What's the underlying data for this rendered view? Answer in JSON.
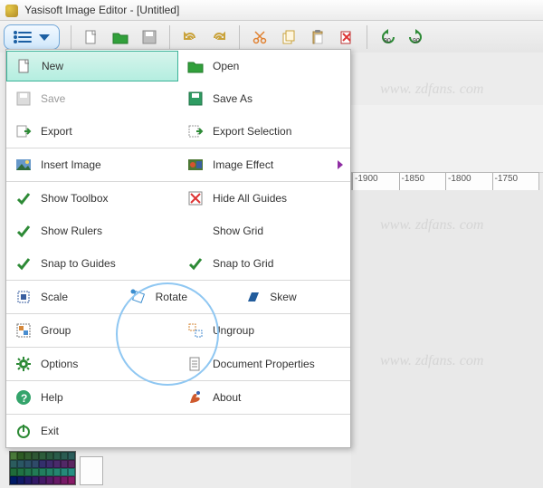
{
  "title": "Yasisoft Image Editor - [Untitled]",
  "toolbar_icons": [
    "menu",
    "new-doc",
    "open-folder",
    "save-disk",
    "undo",
    "redo",
    "cut",
    "copy",
    "paste",
    "delete",
    "rotate-left",
    "rotate-right"
  ],
  "ruler_labels": [
    "-1900",
    "-1850",
    "-1800",
    "-1750"
  ],
  "menu": {
    "new": "New",
    "open": "Open",
    "save": "Save",
    "save_as": "Save As",
    "export": "Export",
    "export_selection": "Export Selection",
    "insert_image": "Insert Image",
    "image_effect": "Image Effect",
    "show_toolbox": "Show Toolbox",
    "hide_guides": "Hide All Guides",
    "show_rulers": "Show Rulers",
    "show_grid": "Show Grid",
    "snap_guides": "Snap to Guides",
    "snap_grid": "Snap to Grid",
    "scale": "Scale",
    "rotate": "Rotate",
    "skew": "Skew",
    "group": "Group",
    "ungroup": "Ungroup",
    "options": "Options",
    "doc_props": "Document Properties",
    "help": "Help",
    "about": "About",
    "exit": "Exit"
  },
  "palette_colors": [
    "#4a7a3a",
    "#2e5c24",
    "#335e2f",
    "#2f5735",
    "#2e5e3b",
    "#2a5a3f",
    "#2a5c4a",
    "#2b5c52",
    "#2c5e5c",
    "#2b5c5e",
    "#2a5664",
    "#2c5067",
    "#2f4a69",
    "#332f6c",
    "#3e2c6d",
    "#4a2a6b",
    "#522866",
    "#5a2660",
    "#1f6b3a",
    "#207143",
    "#21754c",
    "#227a55",
    "#227e5e",
    "#238266",
    "#248670",
    "#258a79",
    "#268e82",
    "#001a66",
    "#111a66",
    "#221a66",
    "#331a66",
    "#441a66",
    "#551a66",
    "#661a66",
    "#771a66",
    "#881a66"
  ]
}
